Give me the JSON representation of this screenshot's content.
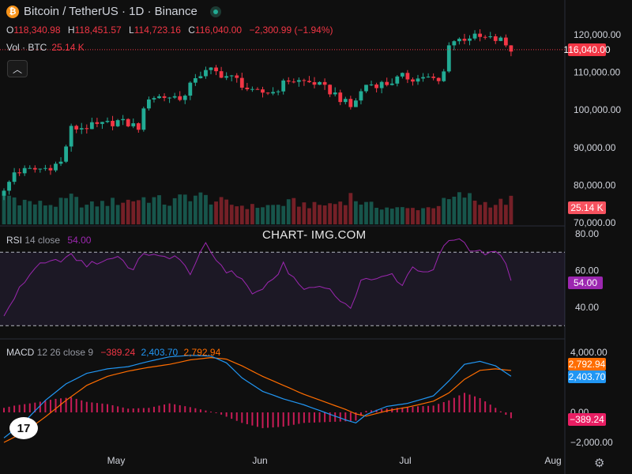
{
  "header": {
    "title": "Bitcoin / TetherUS · 1D · Binance",
    "ohlc": [
      {
        "key": "O",
        "value": "118,340.98"
      },
      {
        "key": "H",
        "value": "118,451.57"
      },
      {
        "key": "L",
        "value": "114,723.16"
      },
      {
        "key": "C",
        "value": "116,040.00"
      }
    ],
    "change": "−2,300.99 (−1.94%)",
    "volume_label": "Vol · BTC",
    "volume_value": "25.14 K"
  },
  "watermark": "CHART- IMG.COM",
  "colors": {
    "up": "#22ab94",
    "down": "#f23645",
    "rsi": "#9c27b0",
    "macd": "#2196f3",
    "signal": "#ff6d00",
    "histogram": "#e91e63",
    "background": "#0f0f0f"
  },
  "icons": [
    "bitcoin-icon",
    "live-status-icon",
    "collapse-chevron-icon",
    "tradingview-logo-icon",
    "settings-icon"
  ],
  "badges": {
    "price": "116,040.00",
    "volume": "25.14 K",
    "rsi": "54.00",
    "signal": "2,792.94",
    "macd": "2,403.70",
    "histogram": "−389.24"
  },
  "rsi_label": {
    "name": "RSI",
    "params": "14 close",
    "value": "54.00"
  },
  "macd_label": {
    "name": "MACD",
    "params": "12 26 close 9",
    "histogram": "−389.24",
    "macd": "2,403.70",
    "signal": "2,792.94"
  },
  "chart_data": {
    "type": "candlestick",
    "title": "Bitcoin / TetherUS · 1D · Binance",
    "x_ticks": [
      "May",
      "Jun",
      "Jul",
      "Aug"
    ],
    "price_axis": {
      "ticks": [
        "120,000.00",
        "110,000.00",
        "100,000.00",
        "90,000.00",
        "80,000.00",
        "70,000.00"
      ],
      "range": [
        70000,
        125000
      ]
    },
    "rsi_axis": {
      "ticks": [
        "80.00",
        "60.00",
        "40.00"
      ],
      "range": [
        25,
        85
      ],
      "band": [
        30,
        70
      ]
    },
    "macd_axis": {
      "ticks": [
        "4,000.00",
        "0.00",
        "−2,000.00"
      ],
      "range": [
        -2300,
        4400
      ]
    },
    "last_price_line": 116040,
    "waypoints": [
      [
        0,
        78000
      ],
      [
        2,
        83500
      ],
      [
        8,
        84500
      ],
      [
        11,
        86000
      ],
      [
        13,
        95000
      ],
      [
        19,
        96000
      ],
      [
        22,
        97000
      ],
      [
        26,
        95500
      ],
      [
        28,
        103500
      ],
      [
        35,
        103500
      ],
      [
        37,
        109000
      ],
      [
        40,
        110500
      ],
      [
        45,
        108000
      ],
      [
        48,
        104500
      ],
      [
        52,
        104800
      ],
      [
        55,
        108000
      ],
      [
        60,
        107200
      ],
      [
        64,
        104200
      ],
      [
        67,
        100700
      ],
      [
        70,
        106800
      ],
      [
        74,
        107000
      ],
      [
        77,
        108800
      ],
      [
        80,
        108300
      ],
      [
        81,
        109000
      ],
      [
        84,
        107400
      ],
      [
        85,
        110000
      ],
      [
        86,
        118000
      ],
      [
        90,
        119500
      ],
      [
        96,
        118500
      ],
      [
        98,
        116040
      ]
    ],
    "rsi_waypoints": [
      [
        0,
        35
      ],
      [
        3,
        50
      ],
      [
        6,
        62
      ],
      [
        10,
        65
      ],
      [
        13,
        68
      ],
      [
        16,
        63
      ],
      [
        20,
        66
      ],
      [
        22,
        68
      ],
      [
        25,
        60
      ],
      [
        27,
        70
      ],
      [
        30,
        67
      ],
      [
        33,
        68
      ],
      [
        36,
        59
      ],
      [
        39,
        74
      ],
      [
        41,
        66
      ],
      [
        43,
        60
      ],
      [
        46,
        56
      ],
      [
        48,
        47
      ],
      [
        52,
        54
      ],
      [
        54,
        64
      ],
      [
        56,
        55
      ],
      [
        58,
        50
      ],
      [
        62,
        52
      ],
      [
        65,
        44
      ],
      [
        67,
        38
      ],
      [
        69,
        56
      ],
      [
        72,
        55
      ],
      [
        75,
        58
      ],
      [
        77,
        52
      ],
      [
        79,
        63
      ],
      [
        81,
        58
      ],
      [
        83,
        60
      ],
      [
        85,
        74
      ],
      [
        88,
        78
      ],
      [
        90,
        72
      ],
      [
        92,
        70
      ],
      [
        94,
        69
      ],
      [
        95,
        70
      ],
      [
        97,
        65
      ],
      [
        98,
        54
      ]
    ],
    "macd_waypoints": [
      [
        0,
        -1700
      ],
      [
        4,
        -600
      ],
      [
        8,
        800
      ],
      [
        12,
        1900
      ],
      [
        16,
        2600
      ],
      [
        20,
        2900
      ],
      [
        24,
        3050
      ],
      [
        28,
        3400
      ],
      [
        32,
        3700
      ],
      [
        36,
        3800
      ],
      [
        40,
        3750
      ],
      [
        43,
        3300
      ],
      [
        46,
        2300
      ],
      [
        50,
        1400
      ],
      [
        54,
        900
      ],
      [
        58,
        500
      ],
      [
        62,
        0
      ],
      [
        66,
        -500
      ],
      [
        68,
        -700
      ],
      [
        70,
        -150
      ],
      [
        74,
        400
      ],
      [
        78,
        600
      ],
      [
        80,
        800
      ],
      [
        83,
        1100
      ],
      [
        86,
        2100
      ],
      [
        89,
        3200
      ],
      [
        92,
        3400
      ],
      [
        95,
        3100
      ],
      [
        98,
        2403.7
      ]
    ],
    "signal_waypoints": [
      [
        0,
        -2000
      ],
      [
        4,
        -1300
      ],
      [
        8,
        -300
      ],
      [
        12,
        800
      ],
      [
        16,
        1800
      ],
      [
        20,
        2400
      ],
      [
        24,
        2750
      ],
      [
        28,
        3000
      ],
      [
        32,
        3200
      ],
      [
        36,
        3500
      ],
      [
        40,
        3650
      ],
      [
        43,
        3550
      ],
      [
        46,
        3100
      ],
      [
        50,
        2400
      ],
      [
        54,
        1800
      ],
      [
        58,
        1200
      ],
      [
        62,
        700
      ],
      [
        66,
        200
      ],
      [
        68,
        -100
      ],
      [
        70,
        -250
      ],
      [
        74,
        100
      ],
      [
        78,
        350
      ],
      [
        80,
        500
      ],
      [
        83,
        750
      ],
      [
        86,
        1300
      ],
      [
        89,
        2200
      ],
      [
        92,
        2800
      ],
      [
        95,
        2900
      ],
      [
        98,
        2792.94
      ]
    ],
    "histogram_waypoints": [
      [
        0,
        300
      ],
      [
        2,
        450
      ],
      [
        6,
        650
      ],
      [
        10,
        900
      ],
      [
        13,
        1000
      ],
      [
        16,
        700
      ],
      [
        20,
        550
      ],
      [
        24,
        250
      ],
      [
        28,
        300
      ],
      [
        32,
        600
      ],
      [
        36,
        350
      ],
      [
        40,
        50
      ],
      [
        42,
        -150
      ],
      [
        46,
        -700
      ],
      [
        50,
        -1050
      ],
      [
        54,
        -950
      ],
      [
        58,
        -700
      ],
      [
        62,
        -650
      ],
      [
        66,
        -600
      ],
      [
        68,
        -550
      ],
      [
        70,
        100
      ],
      [
        74,
        250
      ],
      [
        78,
        350
      ],
      [
        80,
        400
      ],
      [
        83,
        450
      ],
      [
        86,
        800
      ],
      [
        89,
        1300
      ],
      [
        92,
        950
      ],
      [
        95,
        300
      ],
      [
        98,
        -389.24
      ]
    ],
    "volume_waypoints": [
      [
        0,
        1.0
      ],
      [
        3,
        0.75
      ],
      [
        6,
        0.55
      ],
      [
        10,
        0.5
      ],
      [
        13,
        0.8
      ],
      [
        16,
        0.45
      ],
      [
        20,
        0.6
      ],
      [
        24,
        0.7
      ],
      [
        28,
        0.85
      ],
      [
        32,
        0.55
      ],
      [
        36,
        1.0
      ],
      [
        40,
        0.75
      ],
      [
        44,
        0.5
      ],
      [
        48,
        0.4
      ],
      [
        52,
        0.45
      ],
      [
        56,
        0.6
      ],
      [
        60,
        0.45
      ],
      [
        64,
        0.55
      ],
      [
        67,
        0.9
      ],
      [
        70,
        0.5
      ],
      [
        74,
        0.35
      ],
      [
        78,
        0.3
      ],
      [
        82,
        0.35
      ],
      [
        86,
        0.7
      ],
      [
        89,
        0.95
      ],
      [
        92,
        0.6
      ],
      [
        95,
        0.55
      ],
      [
        98,
        0.7
      ]
    ],
    "candle_count": 99
  }
}
